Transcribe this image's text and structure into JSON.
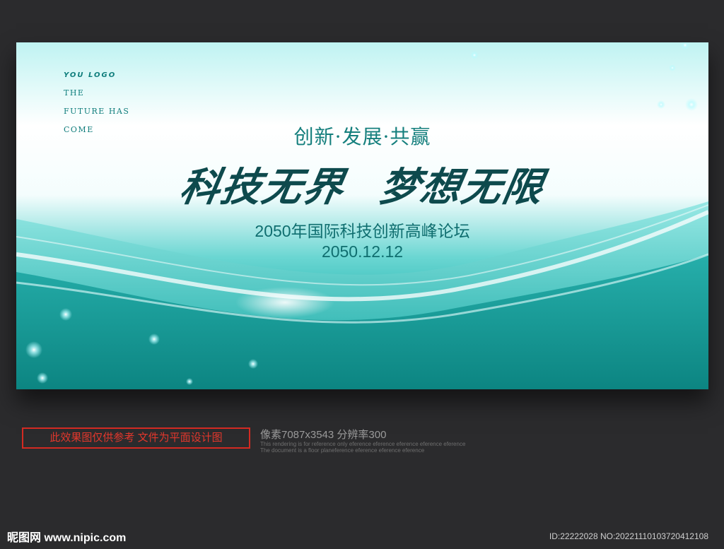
{
  "poster": {
    "logo": "YOU LOGO",
    "tagline": [
      "THE",
      "FUTURE HAS",
      "COME"
    ],
    "slogan": "创新·发展·共赢",
    "headline_left": "科技无界",
    "headline_right": "梦想无限",
    "forum": "2050年国际科技创新高峰论坛",
    "date": "2050.12.12"
  },
  "footer": {
    "notice": "此效果图仅供参考 文件为平面设计图",
    "spec": "像素7087x3543  分辨率300",
    "fine1": "This rendering is for reference only  eference eference eference eference eference",
    "fine2": "The document is a floor planeference eference eference eference",
    "watermark_cn": "昵图网",
    "watermark_url": "www.nipic.com",
    "id_line": "ID:22222028 NO:20221110103720412108"
  },
  "colors": {
    "background": "#2b2b2d",
    "teal_dark": "#0e4a4d",
    "teal": "#157f7d",
    "notice_red": "#d32a22"
  }
}
